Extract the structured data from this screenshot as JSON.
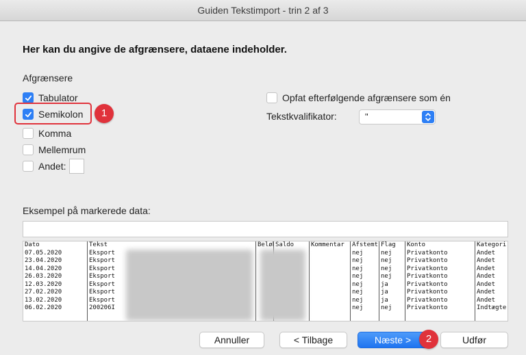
{
  "window": {
    "title": "Guiden Tekstimport - trin 2 af 3"
  },
  "heading": "Her kan du angive de afgrænsere, dataene indeholder.",
  "delimiters": {
    "label": "Afgrænsere",
    "tab_label": "Tabulator",
    "semicolon_label": "Semikolon",
    "comma_label": "Komma",
    "space_label": "Mellemrum",
    "other_label": "Andet:",
    "tab_checked": true,
    "semicolon_checked": true,
    "comma_checked": false,
    "space_checked": false,
    "other_checked": false
  },
  "options": {
    "consecutive_label": "Opfat efterfølgende afgrænsere som én",
    "consecutive_checked": false,
    "qualifier_label": "Tekstkvalifikator:",
    "qualifier_value": "\""
  },
  "preview": {
    "label": "Eksempel på markerede data:",
    "columns": [
      {
        "header": "Dato",
        "cells": [
          "07.05.2020",
          "23.04.2020",
          "14.04.2020",
          "26.03.2020",
          "12.03.2020",
          "27.02.2020",
          "13.02.2020",
          "06.02.2020"
        ]
      },
      {
        "header": "Tekst",
        "cells": [
          "Eksport",
          "Eksport",
          "Eksport",
          "Eksport",
          "Eksport",
          "Eksport",
          "Eksport",
          "200206I"
        ]
      },
      {
        "header": "Beløb",
        "cells": [
          "",
          "",
          "",
          "",
          "",
          "",
          "",
          ""
        ]
      },
      {
        "header": "Saldo",
        "cells": [
          "",
          "",
          "",
          "",
          "",
          "",
          "",
          ""
        ]
      },
      {
        "header": "Kommentar",
        "cells": [
          "",
          "",
          "",
          "",
          "",
          "",
          "",
          ""
        ]
      },
      {
        "header": "Afstemt",
        "cells": [
          "nej",
          "nej",
          "nej",
          "nej",
          "nej",
          "nej",
          "nej",
          "nej"
        ]
      },
      {
        "header": "Flag",
        "cells": [
          "nej",
          "nej",
          "nej",
          "nej",
          "ja",
          "ja",
          "ja",
          "nej"
        ]
      },
      {
        "header": "Konto",
        "cells": [
          "Privatkonto",
          "Privatkonto",
          "Privatkonto",
          "Privatkonto",
          "Privatkonto",
          "Privatkonto",
          "Privatkonto",
          "Privatkonto"
        ]
      },
      {
        "header": "Kategori",
        "cells": [
          "Andet",
          "Andet",
          "Andet",
          "Andet",
          "Andet",
          "Andet",
          "Andet",
          "Indtægte"
        ]
      }
    ]
  },
  "annotations": {
    "badge1": "1",
    "badge2": "2"
  },
  "buttons": {
    "cancel": "Annuller",
    "back": "< Tilbage",
    "next": "Næste >",
    "finish": "Udfør"
  },
  "colors": {
    "accent": "#2d7ff5",
    "annotation": "#e0323b"
  }
}
